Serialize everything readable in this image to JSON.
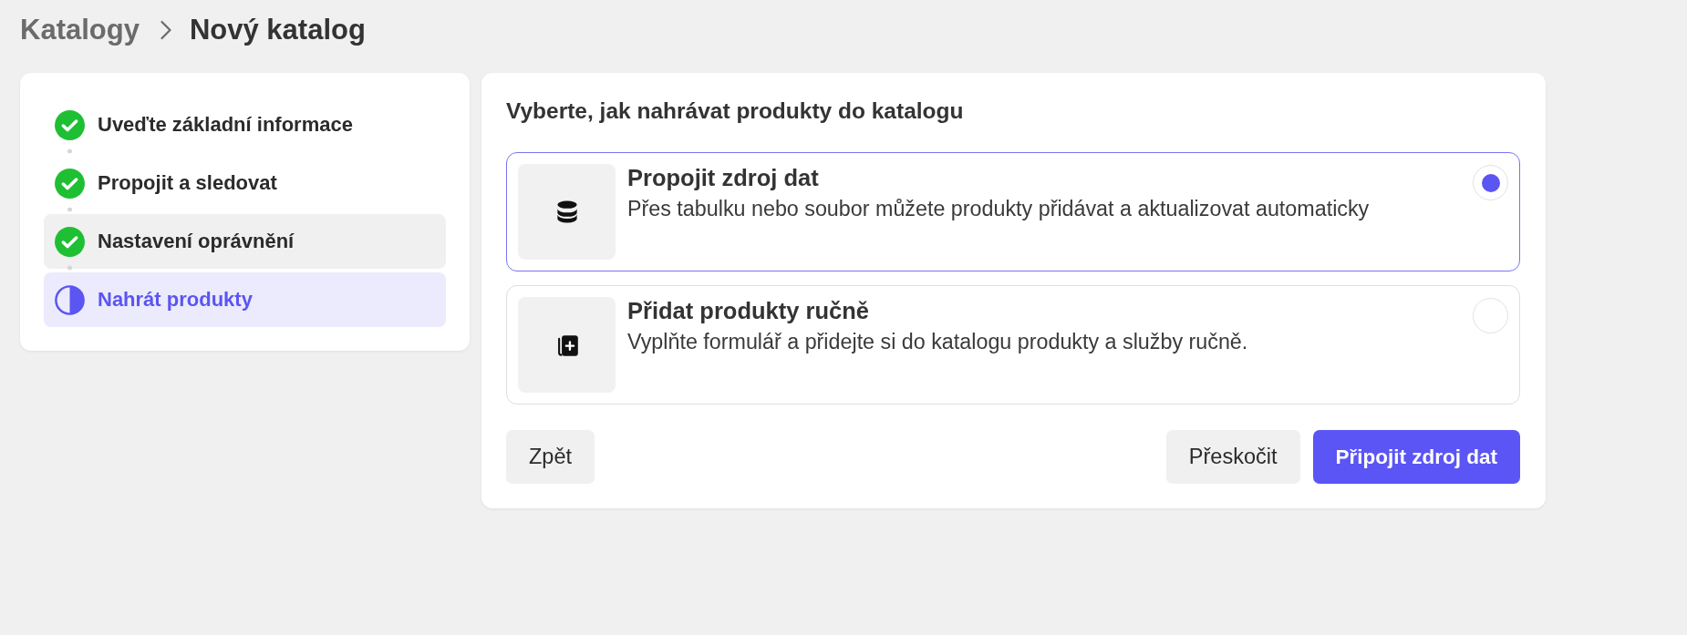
{
  "breadcrumb": {
    "items": [
      {
        "label": "Katalogy",
        "current": false
      },
      {
        "label": "Nový katalog",
        "current": true
      }
    ]
  },
  "steps": [
    {
      "label": "Uveďte základní informace",
      "completed": true,
      "selected": false,
      "hovered": false
    },
    {
      "label": "Propojit a sledovat",
      "completed": true,
      "selected": false,
      "hovered": false
    },
    {
      "label": "Nastavení oprávnění",
      "completed": true,
      "selected": false,
      "hovered": true
    },
    {
      "label": "Nahrát produkty",
      "completed": false,
      "selected": true,
      "hovered": false
    }
  ],
  "upload": {
    "heading": "Vyberte, jak nahrávat produkty do katalogu",
    "options": [
      {
        "kind": "data-source",
        "title": "Propojit zdroj dat",
        "description": "Přes tabulku nebo soubor můžete produkty přidávat a aktualizovat automaticky",
        "selected": true
      },
      {
        "kind": "manual",
        "title": "Přidat produkty ručně",
        "description": "Vyplňte formulář a přidejte si do katalogu produkty a služby ručně.",
        "selected": false
      }
    ],
    "back_button": {
      "label": "Zpět"
    },
    "actions": [
      {
        "label": "Přeskočit",
        "kind": "secondary"
      },
      {
        "label": "Připojit zdroj dat",
        "kind": "primary"
      }
    ]
  }
}
